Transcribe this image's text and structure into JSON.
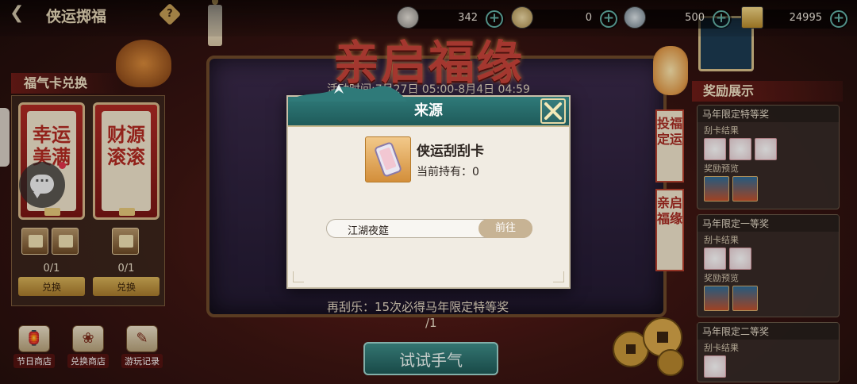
{
  "header": {
    "back_icon": "back-arrow-icon",
    "title": "侠运掷福",
    "help_icon": "help-diamond-icon"
  },
  "currencies": [
    {
      "icon": "dice-icon",
      "value": "342"
    },
    {
      "icon": "token-icon",
      "value": "0"
    },
    {
      "icon": "silver-coin-icon",
      "value": "500"
    },
    {
      "icon": "scratch-card-icon",
      "value": "24995"
    }
  ],
  "event": {
    "big_title": "亲启福缘",
    "time_text": "活动时间:7月27日 05:00-8月4日 04:59",
    "hint": "再刮乐：15次必得马年限定特等奖",
    "progress": "/1",
    "try_button": "试试手气"
  },
  "left_panel": {
    "title": "福气卡兑换",
    "cards": [
      {
        "text": "幸运美满",
        "count": "0/1",
        "button": "兑换"
      },
      {
        "text": "财源滚滚",
        "count": "0/1",
        "button": "兑换"
      }
    ]
  },
  "bottom_nav": [
    {
      "icon": "shop-icon",
      "label": "节日商店"
    },
    {
      "icon": "exchange-shop-icon",
      "label": "兑换商店"
    },
    {
      "icon": "record-icon",
      "label": "游玩记录"
    }
  ],
  "right_panel": {
    "title": "奖励展示",
    "banners": [
      "投福定运",
      "亲启福缘"
    ],
    "prizes": [
      {
        "title": "马年限定特等奖",
        "card_label": "刮卡结果",
        "reward_label": "奖励预览"
      },
      {
        "title": "马年限定一等奖",
        "card_label": "刮卡结果",
        "reward_label": "奖励预览"
      },
      {
        "title": "马年限定二等奖",
        "card_label": "刮卡结果"
      }
    ]
  },
  "modal": {
    "title": "来源",
    "item_name": "侠运刮刮卡",
    "held_text": "当前持有：0",
    "source_label": "江湖夜筵",
    "goto_button": "前往",
    "close_icon": "close-x-icon"
  },
  "colors": {
    "teal_header": "#2f7a79",
    "modal_bg": "#f1ece3",
    "goto_button": "#c7b394",
    "title_red": "#c9443a",
    "gold_button": "#d9b45a"
  }
}
